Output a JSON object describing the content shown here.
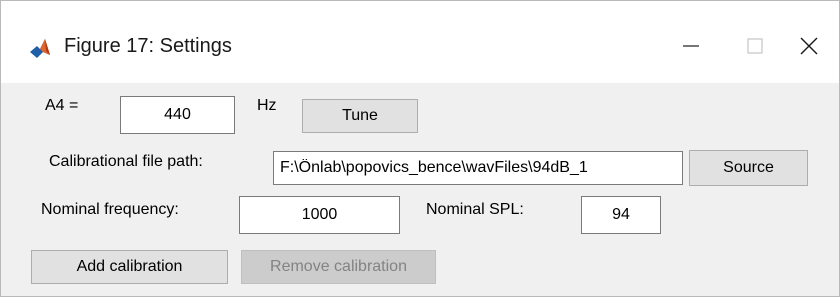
{
  "window": {
    "title": "Figure 17: Settings",
    "app_icon": "matlab-icon",
    "controls": {
      "minimize": "minimize-icon",
      "maximize": "maximize-icon",
      "close": "close-icon"
    }
  },
  "tuning": {
    "label": "A4 =",
    "value": "440",
    "unit": "Hz",
    "tune_button": "Tune"
  },
  "calibration": {
    "path_label": "Calibrational file path:",
    "path_value": "F:\\Önlab\\popovics_bence\\wavFiles\\94dB_1",
    "source_button": "Source",
    "nominal_frequency_label": "Nominal frequency:",
    "nominal_frequency_value": "1000",
    "nominal_spl_label": "Nominal SPL:",
    "nominal_spl_value": "94",
    "add_button": "Add calibration",
    "remove_button": "Remove calibration"
  }
}
